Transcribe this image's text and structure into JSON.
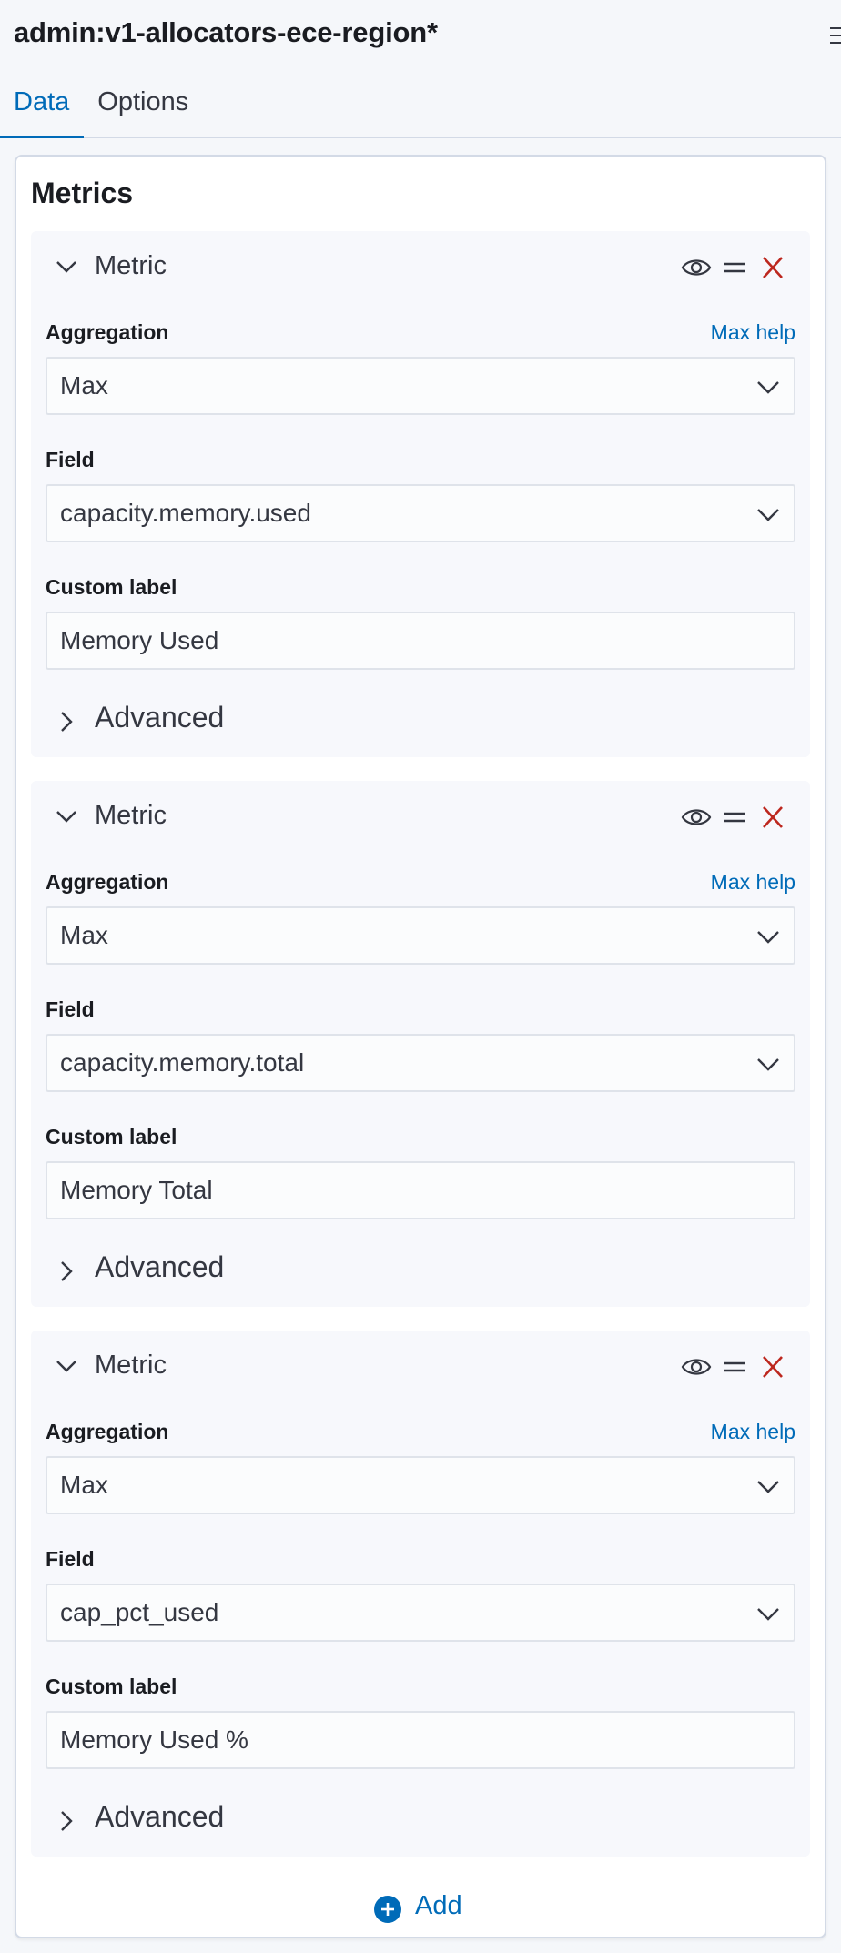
{
  "header": {
    "title": "admin:v1-allocators-ece-region*",
    "tabs": [
      {
        "label": "Data",
        "active": true
      },
      {
        "label": "Options",
        "active": false
      }
    ]
  },
  "panel": {
    "title": "Metrics",
    "metrics": [
      {
        "label": "Metric",
        "aggregation_label": "Aggregation",
        "help_link": "Max help",
        "aggregation_value": "Max",
        "field_label": "Field",
        "field_value": "capacity.memory.used",
        "custom_label_label": "Custom label",
        "custom_label_value": "Memory Used",
        "advanced_label": "Advanced"
      },
      {
        "label": "Metric",
        "aggregation_label": "Aggregation",
        "help_link": "Max help",
        "aggregation_value": "Max",
        "field_label": "Field",
        "field_value": "capacity.memory.total",
        "custom_label_label": "Custom label",
        "custom_label_value": "Memory Total",
        "advanced_label": "Advanced"
      },
      {
        "label": "Metric",
        "aggregation_label": "Aggregation",
        "help_link": "Max help",
        "aggregation_value": "Max",
        "field_label": "Field",
        "field_value": "cap_pct_used",
        "custom_label_label": "Custom label",
        "custom_label_value": "Memory Used %",
        "advanced_label": "Advanced"
      }
    ],
    "add_label": "Add"
  },
  "icons": {
    "collapse": "chevron-down-icon",
    "visibility": "eye-icon",
    "drag": "drag-handle-icon",
    "remove": "close-icon",
    "expand": "chevron-right-icon",
    "add": "plus-circle-icon",
    "menu": "menu-icon"
  },
  "colors": {
    "accent": "#006bb8",
    "danger": "#bd271e",
    "text": "#343741",
    "heading": "#1a1c21",
    "panel_bg": "#ffffff",
    "metric_bg": "#f7f8fc",
    "page_bg": "#f5f7fa"
  }
}
